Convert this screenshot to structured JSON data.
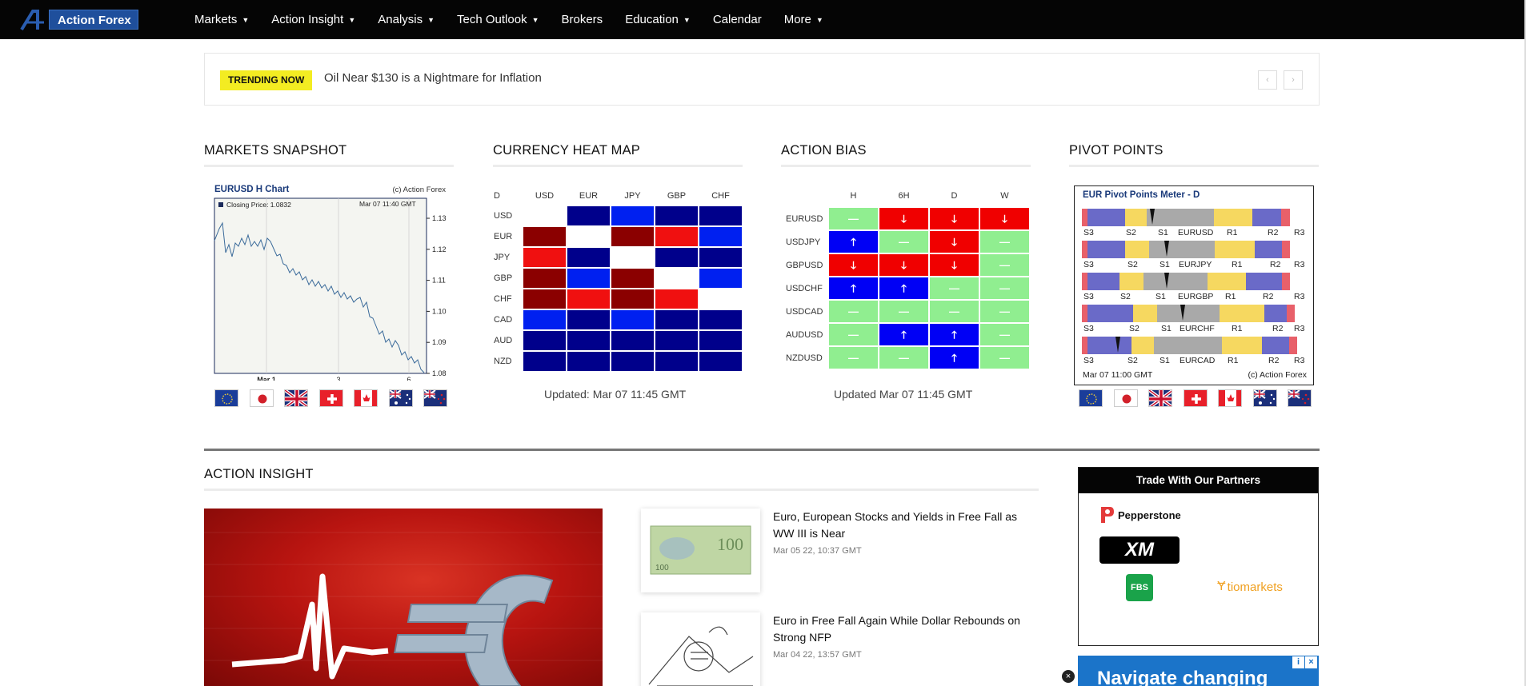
{
  "nav": {
    "logo_text": "Action Forex",
    "items": [
      {
        "label": "Markets",
        "has_menu": true
      },
      {
        "label": "Action Insight",
        "has_menu": true
      },
      {
        "label": "Analysis",
        "has_menu": true
      },
      {
        "label": "Tech Outlook",
        "has_menu": true
      },
      {
        "label": "Brokers",
        "has_menu": false
      },
      {
        "label": "Education",
        "has_menu": true
      },
      {
        "label": "Calendar",
        "has_menu": false
      },
      {
        "label": "More",
        "has_menu": true
      }
    ]
  },
  "trending": {
    "badge": "TRENDING NOW",
    "headline": "Oil Near $130 is a Nightmare for Inflation",
    "prev_label": "‹",
    "next_label": "›"
  },
  "markets_snapshot": {
    "title": "MARKETS SNAPSHOT",
    "chart_title": "EURUSD H Chart",
    "chart_copyright": "(c) Action Forex",
    "legend": "Closing Price: 1.0832",
    "timestamp": "Mar 07 11:40 GMT",
    "y_ticks": [
      "1.13",
      "1.12",
      "1.11",
      "1.10",
      "1.09",
      "1.08"
    ],
    "x_ticks": [
      "Mar 1",
      "3",
      "6"
    ],
    "flags": [
      "EUR",
      "JPY",
      "GBP",
      "CHF",
      "CAD",
      "AUD",
      "NZD"
    ]
  },
  "heat_map": {
    "title": "CURRENCY HEAT MAP",
    "corner": "D",
    "columns": [
      "USD",
      "EUR",
      "JPY",
      "GBP",
      "CHF"
    ],
    "rows": [
      "USD",
      "EUR",
      "JPY",
      "GBP",
      "CHF",
      "CAD",
      "AUD",
      "NZD"
    ],
    "colors": {
      "darkblue": "#00008b",
      "blue": "#0020f0",
      "darkred": "#8b0000",
      "red": "#f01010",
      "white": "#ffffff"
    },
    "cells": [
      [
        "white",
        "darkblue",
        "blue",
        "darkblue",
        "darkblue"
      ],
      [
        "darkred",
        "white",
        "darkred",
        "red",
        "blue"
      ],
      [
        "red",
        "darkblue",
        "white",
        "darkblue",
        "darkblue"
      ],
      [
        "darkred",
        "blue",
        "darkred",
        "white",
        "blue"
      ],
      [
        "darkred",
        "red",
        "darkred",
        "red",
        "white"
      ],
      [
        "blue",
        "darkblue",
        "blue",
        "darkblue",
        "darkblue"
      ],
      [
        "darkblue",
        "darkblue",
        "darkblue",
        "darkblue",
        "darkblue"
      ],
      [
        "darkblue",
        "darkblue",
        "darkblue",
        "darkblue",
        "darkblue"
      ]
    ],
    "updated": "Updated: Mar 07 11:45 GMT"
  },
  "action_bias": {
    "title": "ACTION BIAS",
    "columns": [
      "H",
      "6H",
      "D",
      "W"
    ],
    "rows": [
      {
        "pair": "EURUSD",
        "cells": [
          "flat",
          "down",
          "down",
          "down"
        ]
      },
      {
        "pair": "USDJPY",
        "cells": [
          "up",
          "flat",
          "down",
          "flat"
        ]
      },
      {
        "pair": "GBPUSD",
        "cells": [
          "down",
          "down",
          "down",
          "flat"
        ]
      },
      {
        "pair": "USDCHF",
        "cells": [
          "up",
          "up",
          "flat",
          "flat"
        ]
      },
      {
        "pair": "USDCAD",
        "cells": [
          "flat",
          "flat",
          "flat",
          "flat"
        ]
      },
      {
        "pair": "AUDUSD",
        "cells": [
          "flat",
          "up",
          "up",
          "flat"
        ]
      },
      {
        "pair": "NZDUSD",
        "cells": [
          "flat",
          "flat",
          "up",
          "flat"
        ]
      }
    ],
    "colors": {
      "up": "#0000f5",
      "down": "#f00000",
      "flat": "#90ee90"
    },
    "symbols": {
      "up": "🡑",
      "down": "🡓",
      "flat": "—"
    },
    "updated": "Updated Mar 07 11:45 GMT"
  },
  "pivot_points": {
    "title": "PIVOT POINTS",
    "meter_title": "EUR Pivot Points Meter - D",
    "rows": [
      {
        "pair": "EURUSD",
        "labels": [
          "S3",
          "S2",
          "S1",
          "EURUSD",
          "R1",
          "R2",
          "R3"
        ]
      },
      {
        "pair": "EURJPY",
        "labels": [
          "S3",
          "S2",
          "S1",
          "EURJPY",
          "R1",
          "R2",
          "R3"
        ]
      },
      {
        "pair": "EURGBP",
        "labels": [
          "S3",
          "S2",
          "S1",
          "EURGBP",
          "R1",
          "R2",
          "R3"
        ]
      },
      {
        "pair": "EURCHF",
        "labels": [
          "S3",
          "S2",
          "S1",
          "EURCHF",
          "R1",
          "R2",
          "R3"
        ]
      },
      {
        "pair": "EURCAD",
        "labels": [
          "S3",
          "S2",
          "S1",
          "EURCAD",
          "R1",
          "R2",
          "R3"
        ]
      }
    ],
    "footer_left": "Mar 07 11:00 GMT",
    "footer_right": "(c) Action Forex",
    "flags": [
      "EUR",
      "JPY",
      "GBP",
      "CHF",
      "CAD",
      "AUD",
      "NZD"
    ]
  },
  "action_insight": {
    "title": "ACTION INSIGHT",
    "articles": [
      {
        "title": "Euro, European Stocks and Yields in Free Fall as WW III is Near",
        "date": "Mar 05 22, 10:37 GMT"
      },
      {
        "title": "Euro in Free Fall Again While Dollar Rebounds on Strong NFP",
        "date": "Mar 04 22, 13:57 GMT"
      }
    ]
  },
  "partners": {
    "title": "Trade With Our Partners",
    "names": [
      "Pepperstone",
      "XM",
      "FBS",
      "tiomarkets"
    ]
  },
  "ad": {
    "text": "Navigate changing"
  }
}
